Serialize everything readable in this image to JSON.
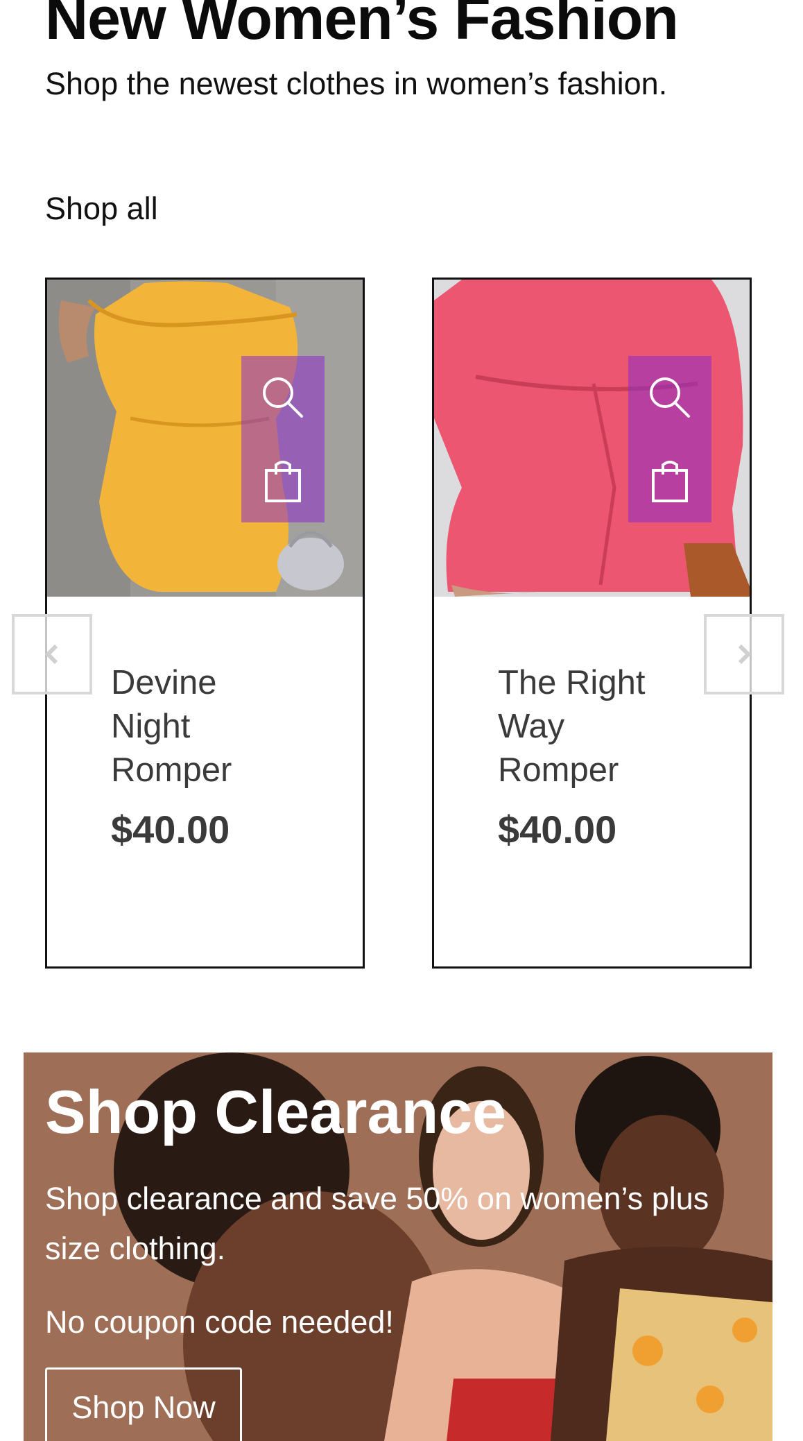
{
  "header": {
    "title": "New Women’s Fashion",
    "subtitle": "Shop the newest clothes in women’s fashion.",
    "shop_all_label": "Shop all"
  },
  "products": [
    {
      "name": "Devine Night Romper",
      "price": "$40.00",
      "image_description": "yellow off-shoulder romper",
      "garment_color": "#f2b53a",
      "icons": [
        "search-icon",
        "shopping-bag-icon"
      ]
    },
    {
      "name": "The Right Way Romper",
      "price": "$40.00",
      "image_description": "coral pink romper",
      "garment_color": "#ec5670",
      "icons": [
        "search-icon",
        "shopping-bag-icon"
      ]
    }
  ],
  "carousel": {
    "prev_icon": "chevron-left-icon",
    "next_icon": "chevron-right-icon"
  },
  "clearance": {
    "title": "Shop Clearance",
    "text": "Shop clearance and save 50% on women’s plus size clothing.",
    "note": "No coupon code needed!",
    "button_label": "Shop Now"
  },
  "colors": {
    "accent_purple": "#8c2dc8",
    "text_dark": "#111111",
    "text_gray": "#3a3a3a",
    "arrow_border": "#d8d8d8",
    "banner_brown": "#9e6e56"
  }
}
